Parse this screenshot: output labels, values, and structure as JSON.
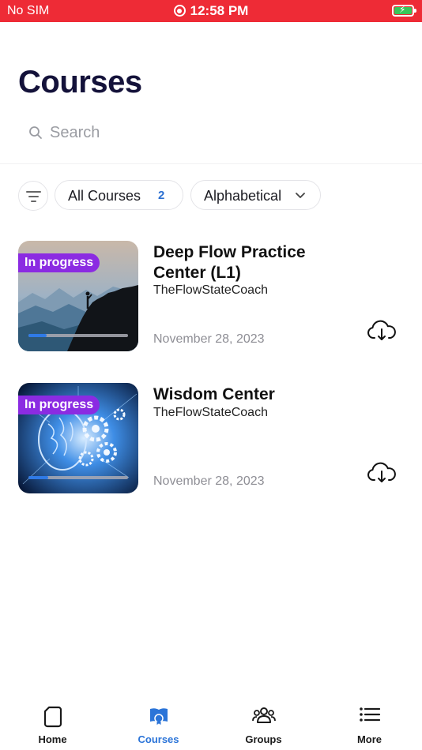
{
  "status_bar": {
    "carrier": "No SIM",
    "time": "12:58 PM"
  },
  "page": {
    "title": "Courses"
  },
  "search": {
    "placeholder": "Search"
  },
  "filters": {
    "category_label": "All Courses",
    "category_count": "2",
    "sort_label": "Alphabetical"
  },
  "courses": [
    {
      "title": "Deep Flow Practice Center (L1)",
      "author": "TheFlowStateCoach",
      "date": "November 28, 2023",
      "status": "In progress",
      "progress": 0.18
    },
    {
      "title": "Wisdom Center",
      "author": "TheFlowStateCoach",
      "date": "November 28, 2023",
      "status": "In progress",
      "progress": 0.2
    }
  ],
  "tab_bar": {
    "items": [
      {
        "label": "Home",
        "icon": "home-icon"
      },
      {
        "label": "Courses",
        "icon": "courses-icon"
      },
      {
        "label": "Groups",
        "icon": "groups-icon"
      },
      {
        "label": "More",
        "icon": "menu-icon"
      }
    ],
    "active": "Courses"
  },
  "colors": {
    "status_bar": "#ee2b36",
    "accent": "#2b74d8",
    "badge": "#8b2be2",
    "title": "#14123a"
  }
}
